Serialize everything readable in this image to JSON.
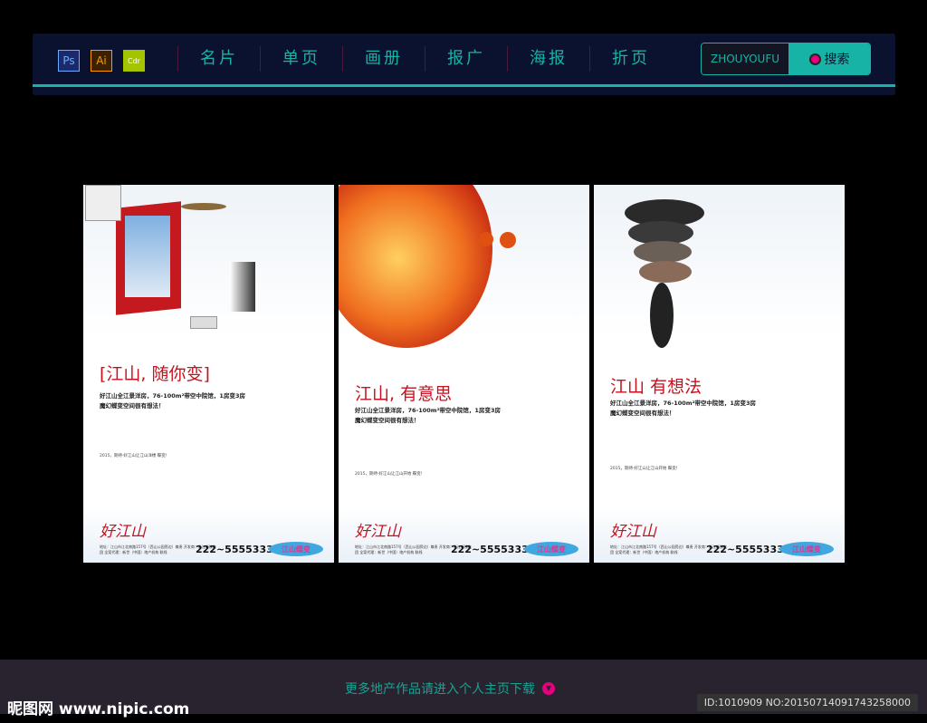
{
  "nav": {
    "apps": [
      {
        "label": "Ps",
        "color": "#6fa8ff"
      },
      {
        "label": "Ai",
        "color": "#ff9a00"
      },
      {
        "label": "Cdr",
        "color": "#a4c400"
      }
    ],
    "items": [
      "名片",
      "单页",
      "画册",
      "报广",
      "海报",
      "折页"
    ],
    "search": {
      "value": "ZHOUYOUFU",
      "button": "搜索"
    }
  },
  "posters": [
    {
      "title": "[江山, 随你变]",
      "sub1": "好江山全江景洋房，76-100m²带空中院馆，1房变3房",
      "sub2": "魔幻蝶变空间很有想法！",
      "tagline": "2015，期待·好江山让江山洋楼 蝶变!"
    },
    {
      "title": "江山, 有意思",
      "sub1": "好江山全江景洋房，76-100m²带空中院馆，1房变3房",
      "sub2": "魔幻蝶变空间很有想法！",
      "tagline": "2015，期待·好江山让江山开始 蝶变!"
    },
    {
      "title": "江山 有想法",
      "sub1": "好江山全江景洋房，76-100m²带空中院馆，1房变3房",
      "sub2": "魔幻蝶变空间很有想法！",
      "tagline": "2015，期待·好江山让江山开始 蝶变!"
    }
  ],
  "poster_common": {
    "logo": "好江山",
    "address": "地址：江山市江北南路157号（西山公园旁边）尊贵 开发商：浙江新铁集团 全案代理：新世（中国）地产机构 联线",
    "phone": "222~55553333",
    "tag": "江山蝶变"
  },
  "footer": {
    "more": "更多地产作品请进入个人主页下载",
    "watermark": "昵图网 www.nipic.com",
    "id": "ID:1010909 NO:20150714091743258000"
  }
}
